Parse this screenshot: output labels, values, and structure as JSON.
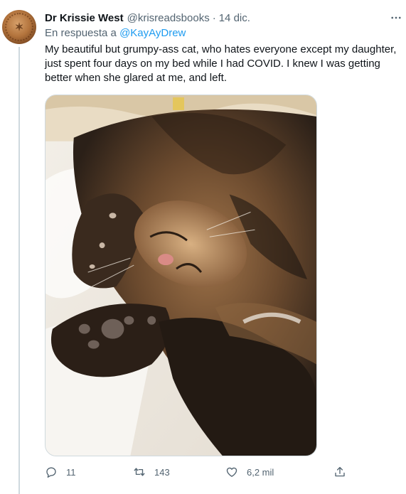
{
  "tweet": {
    "author": {
      "name": "Dr Krissie West",
      "handle": "@krisreadsbooks",
      "date": "14 dic.",
      "separator": "·"
    },
    "reply": {
      "prefix": "En respuesta a",
      "to": "@KayAyDrew"
    },
    "text": "My beautiful but grumpy-ass cat, who hates everyone except my daughter, just spent four days on my bed while I had COVID. I knew I was getting better when she glared at me, and left.",
    "stats": {
      "replies": "11",
      "retweets": "143",
      "likes": "6,2 mil"
    }
  },
  "icons": {
    "more": "more-horizontal-icon",
    "reply": "reply-bubble-icon",
    "retweet": "retweet-icon",
    "like": "heart-icon",
    "share": "share-upload-icon"
  },
  "colors": {
    "link": "#1d9bf0",
    "secondary_text": "#536471",
    "primary_text": "#0f1419",
    "divider": "#cfd9de"
  }
}
